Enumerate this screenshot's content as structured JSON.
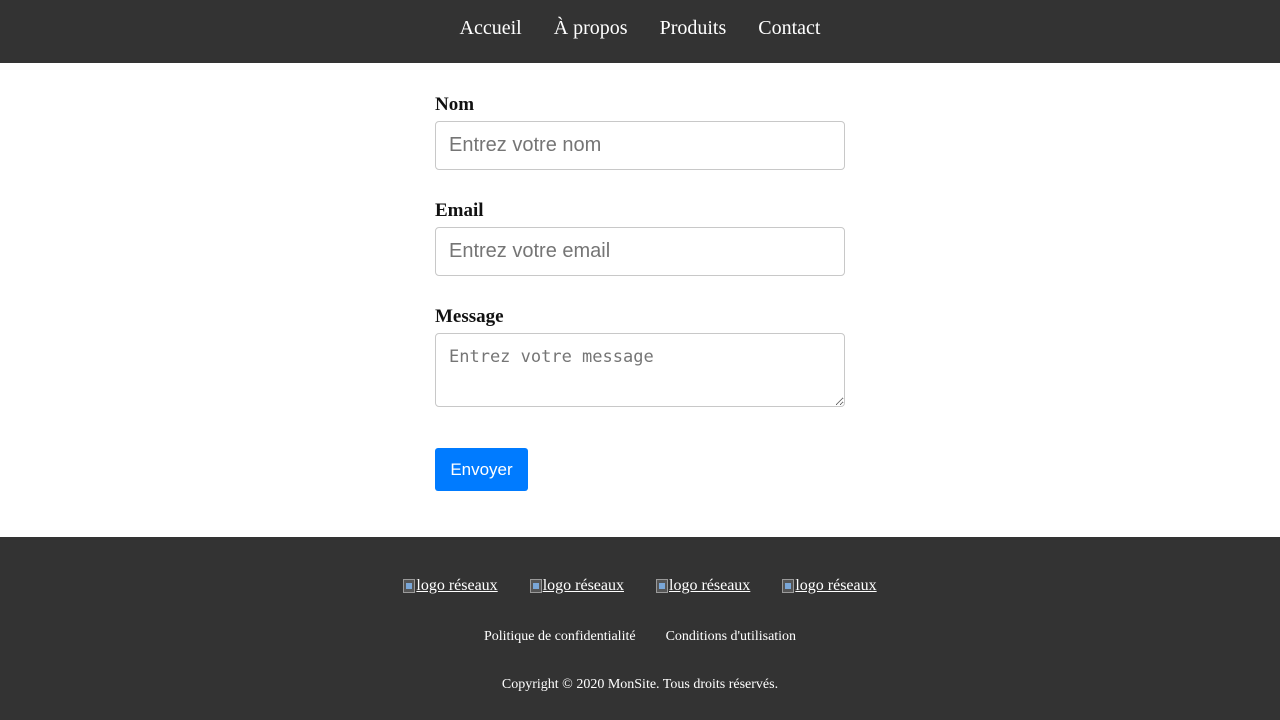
{
  "nav": {
    "items": [
      {
        "label": "Accueil"
      },
      {
        "label": "À propos"
      },
      {
        "label": "Produits"
      },
      {
        "label": "Contact"
      }
    ]
  },
  "form": {
    "name": {
      "label": "Nom",
      "placeholder": "Entrez votre nom",
      "value": ""
    },
    "email": {
      "label": "Email",
      "placeholder": "Entrez votre email",
      "value": ""
    },
    "message": {
      "label": "Message",
      "placeholder": "Entrez votre message",
      "value": ""
    },
    "submit_label": "Envoyer"
  },
  "footer": {
    "social_links": [
      {
        "alt": "logo réseaux",
        "icon": "broken-image-icon"
      },
      {
        "alt": "logo réseaux",
        "icon": "broken-image-icon"
      },
      {
        "alt": "logo réseaux",
        "icon": "broken-image-icon"
      },
      {
        "alt": "logo réseaux",
        "icon": "broken-image-icon"
      }
    ],
    "legal_links": [
      {
        "label": "Politique de confidentialité"
      },
      {
        "label": "Conditions d'utilisation"
      }
    ],
    "copyright": "Copyright © 2020 MonSite. Tous droits réservés."
  },
  "colors": {
    "header_bg": "#333333",
    "footer_bg": "#333333",
    "button_bg": "#007bff"
  }
}
